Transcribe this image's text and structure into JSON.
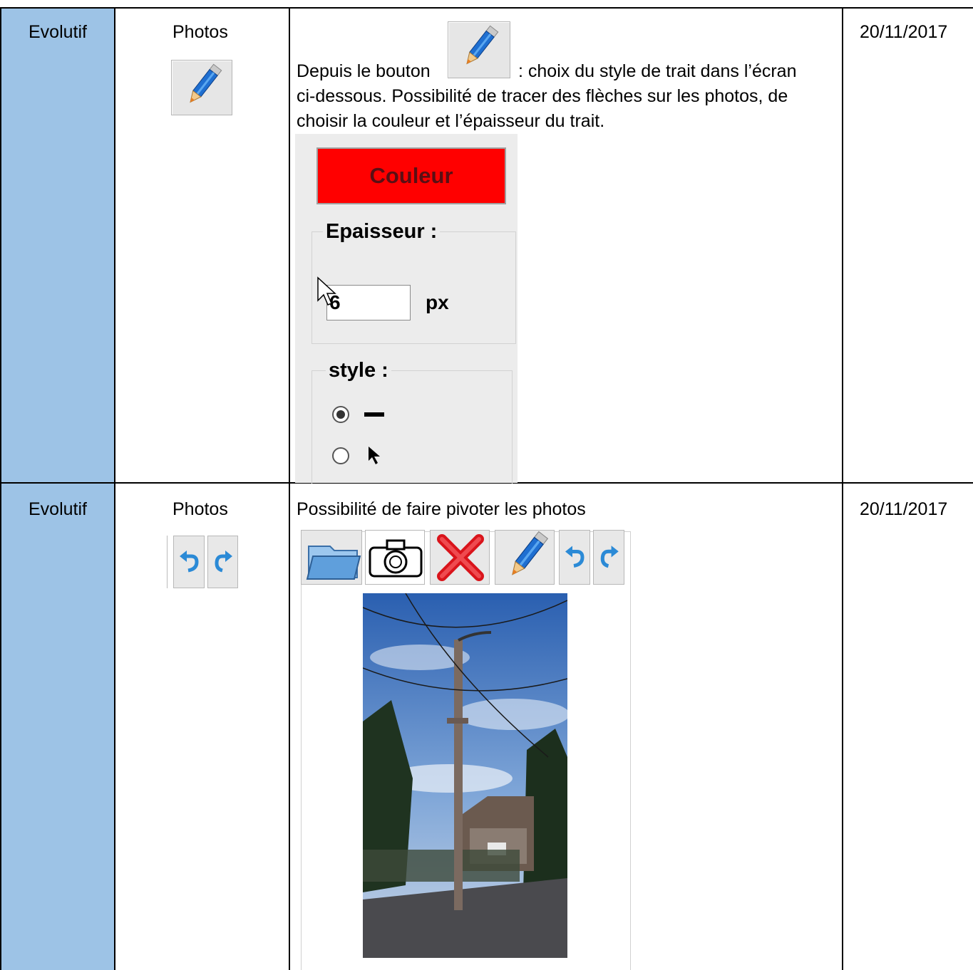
{
  "rows": [
    {
      "type": "Evolutif",
      "category": "Photos",
      "description_before": "Depuis le bouton",
      "description_after": ": choix du style de trait dans l’écran",
      "description_line2": "ci-dessous. Possibilité de tracer des flèches sur les photos, de",
      "description_line3": "choisir la couleur et l’épaisseur du trait.",
      "date": "20/11/2017",
      "panel": {
        "color_button": "Couleur",
        "thickness_legend": "Epaisseur :",
        "thickness_value": "6",
        "thickness_unit": "px",
        "style_legend": "style :",
        "style_options": [
          {
            "icon": "line-icon",
            "selected": true
          },
          {
            "icon": "arrow-cursor-icon",
            "selected": false
          }
        ]
      }
    },
    {
      "type": "Evolutif",
      "category": "Photos",
      "description": "Possibilité de faire pivoter les photos",
      "date": "20/11/2017",
      "toolbar": [
        "folder-icon",
        "camera-icon",
        "delete-icon",
        "pencil-icon",
        "rotate-left-icon",
        "rotate-right-icon"
      ]
    }
  ],
  "colors": {
    "type_column_bg": "#9dc3e6",
    "couleur_button_bg": "#ff0000"
  }
}
